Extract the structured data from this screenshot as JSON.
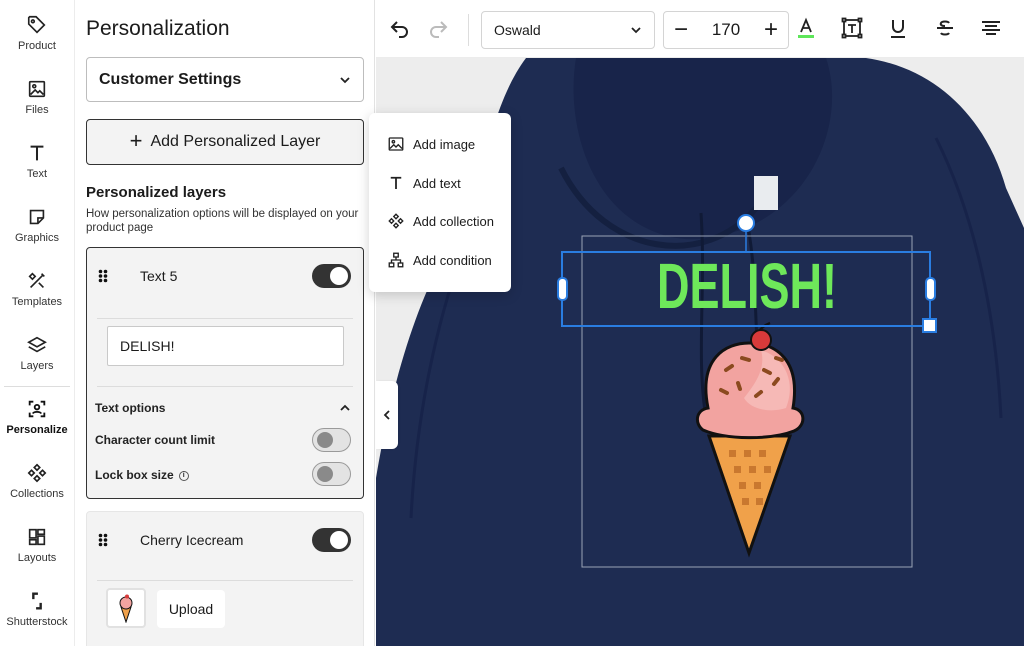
{
  "rail": {
    "items": [
      {
        "label": "Product",
        "icon": "tag-icon"
      },
      {
        "label": "Files",
        "icon": "image-icon"
      },
      {
        "label": "Text",
        "icon": "text-icon"
      },
      {
        "label": "Graphics",
        "icon": "sticker-icon"
      },
      {
        "label": "Templates",
        "icon": "tools-icon"
      },
      {
        "label": "Layers",
        "icon": "layers-icon"
      },
      {
        "label": "Personalize",
        "icon": "person-frame-icon"
      },
      {
        "label": "Collections",
        "icon": "collection-icon"
      },
      {
        "label": "Layouts",
        "icon": "layout-icon"
      },
      {
        "label": "Shutterstock",
        "icon": "shutterstock-icon"
      }
    ],
    "active": "Personalize"
  },
  "panel": {
    "title": "Personalization",
    "customer_settings": "Customer Settings",
    "add_layer_label": "Add Personalized Layer",
    "layers_heading": "Personalized layers",
    "layers_desc": "How personalization options will be displayed on your product page",
    "layers": [
      {
        "name": "Text 5",
        "enabled": true,
        "value": "DELISH!",
        "options_heading": "Text options",
        "char_limit_label": "Character count limit",
        "lock_box_label": "Lock box size",
        "char_limit_enabled": false,
        "lock_box_enabled": false
      },
      {
        "name": "Cherry Icecream",
        "enabled": true,
        "upload_label": "Upload"
      }
    ]
  },
  "toolbar": {
    "font": "Oswald",
    "size": "170",
    "text_color": "#5ee65a"
  },
  "add_menu": {
    "items": [
      {
        "label": "Add image",
        "icon": "image-icon"
      },
      {
        "label": "Add text",
        "icon": "text-icon"
      },
      {
        "label": "Add collection",
        "icon": "collection-icon"
      },
      {
        "label": "Add condition",
        "icon": "condition-icon"
      }
    ]
  },
  "canvas": {
    "text": "DELISH!",
    "text_color": "#6ee85a",
    "hoodie_color": "#1e2c52"
  }
}
